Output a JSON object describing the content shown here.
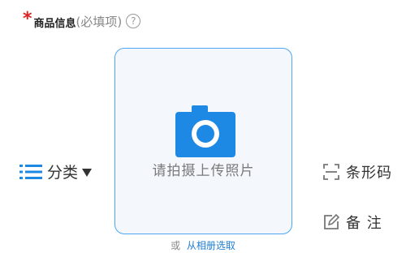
{
  "header": {
    "required_mark": "*",
    "title": "商品信息",
    "hint": "(必填项)",
    "help_icon": "?"
  },
  "photo": {
    "icon": "camera-icon",
    "label": "请拍摄上传照片"
  },
  "album": {
    "or_text": "或",
    "link_text": "从相册选取"
  },
  "category": {
    "icon": "list-icon",
    "label": "分类"
  },
  "barcode": {
    "icon": "scan-icon",
    "label": "条形码"
  },
  "note": {
    "icon": "edit-icon",
    "label": "备 注"
  },
  "colors": {
    "accent": "#1e88e5",
    "required": "#e02020",
    "border": "#4da6f2"
  }
}
